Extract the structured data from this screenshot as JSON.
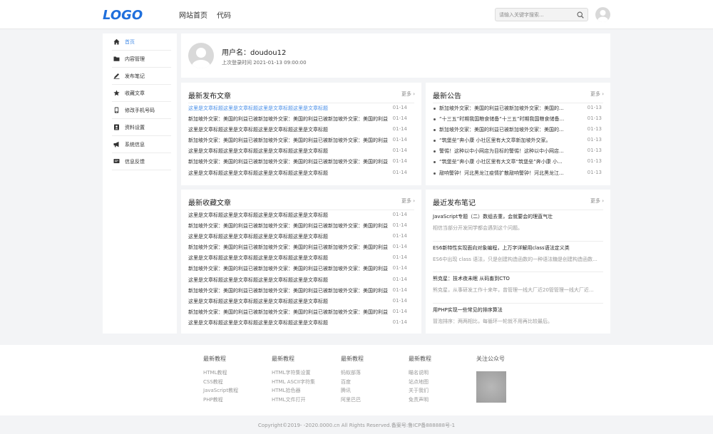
{
  "header": {
    "logo_text": "LOGO",
    "nav": [
      "网站首页",
      "代码"
    ],
    "search_placeholder": "请输入关键字搜索..."
  },
  "colors": {
    "accent": "#4a8fe7",
    "logo": "#1f6fdc",
    "background": "#f3f4f6"
  },
  "sidebar": {
    "items": [
      {
        "label": "首页",
        "icon": "home-icon",
        "active": true
      },
      {
        "label": "内容管理",
        "icon": "folder-icon",
        "active": false
      },
      {
        "label": "发布笔记",
        "icon": "pen-icon",
        "active": false
      },
      {
        "label": "收藏文章",
        "icon": "star-icon",
        "active": false
      },
      {
        "label": "修改手机号码",
        "icon": "phone-icon",
        "active": false
      },
      {
        "label": "资料设置",
        "icon": "id-card-icon",
        "active": false
      },
      {
        "label": "系统信息",
        "icon": "megaphone-icon",
        "active": false
      },
      {
        "label": "信息反馈",
        "icon": "message-icon",
        "active": false
      }
    ]
  },
  "profile": {
    "name": "用户名：doudou12",
    "last_login": "上次登录时间   2021-01-13 09:00:00"
  },
  "latest_articles": {
    "title": "最新发布文章",
    "more": "更多 ›",
    "rows": [
      {
        "title": "这里是文章标题这里是文章标题这里是文章标题这里是文章标题",
        "date": "01-14"
      },
      {
        "title": "新加坡外交家：美国的利益已被新加坡外交家：美国的利益已被新加坡外交家：美国的利益已...",
        "date": "01-14"
      },
      {
        "title": "这里是文章标题这里是文章标题这里是文章标题这里是文章标题",
        "date": "01-14"
      },
      {
        "title": "新加坡外交家：美国的利益已被新加坡外交家：美国的利益已被新加坡外交家：美国的利益已...",
        "date": "01-14"
      },
      {
        "title": "这里是文章标题这里是文章标题这里是文章标题这里是文章标题",
        "date": "01-14"
      },
      {
        "title": "新加坡外交家：美国的利益已被新加坡外交家：美国的利益已被新加坡外交家：美国的利益已...",
        "date": "01-14"
      },
      {
        "title": "这里是文章标题这里是文章标题这里是文章标题这里是文章标题",
        "date": "01-14"
      }
    ]
  },
  "announcements": {
    "title": "最新公告",
    "more": "更多 ›",
    "rows": [
      {
        "title": "新加坡外交家：美国的利益已被新加坡外交家：美国的...",
        "date": "01-13"
      },
      {
        "title": "“十三五”时期我国粮食储备“十三五”时期我国粮食储备...",
        "date": "01-13"
      },
      {
        "title": "新加坡外交家：美国的利益已被新加坡外交家：美国的...",
        "date": "01-13"
      },
      {
        "title": "“筑堡垒”奔小康 小社区里有大文章新加坡外交家。",
        "date": "01-13"
      },
      {
        "title": "警惕！这种以中小网店为目标的警惕！这种以中小网店...",
        "date": "01-13"
      },
      {
        "title": "“筑堡垒”奔小康 小社区里有大文章“筑堡垒”奔小康 小...",
        "date": "01-13"
      },
      {
        "title": "敲响警钟！河北黑龙江疫情扩散敲响警钟！河北黑龙江...",
        "date": "01-13"
      }
    ]
  },
  "favorites": {
    "title": "最新收藏文章",
    "more": "更多 ›",
    "rows": [
      {
        "title": "这里是文章标题这里是文章标题这里是文章标题这里是文章标题",
        "date": "01-14"
      },
      {
        "title": "新加坡外交家：美国的利益已被新加坡外交家：美国的利益已被新加坡外交家：美国的利益已...",
        "date": "01-14"
      },
      {
        "title": "这里是文章标题这里是文章标题这里是文章标题这里是文章标题",
        "date": "01-14"
      },
      {
        "title": "新加坡外交家：美国的利益已被新加坡外交家：美国的利益已被新加坡外交家：美国的利益已...",
        "date": "01-14"
      },
      {
        "title": "这里是文章标题这里是文章标题这里是文章标题这里是文章标题",
        "date": "01-14"
      },
      {
        "title": "新加坡外交家：美国的利益已被新加坡外交家：美国的利益已被新加坡外交家：美国的利益已...",
        "date": "01-14"
      },
      {
        "title": "这里是文章标题这里是文章标题这里是文章标题这里是文章标题",
        "date": "01-14"
      },
      {
        "title": "新加坡外交家：美国的利益已被新加坡外交家：美国的利益已被新加坡外交家：美国的利益已...",
        "date": "01-14"
      },
      {
        "title": "这里是文章标题这里是文章标题这里是文章标题这里是文章标题",
        "date": "01-14"
      },
      {
        "title": "新加坡外交家：美国的利益已被新加坡外交家：美国的利益已被新加坡外交家：美国的利益已...",
        "date": "01-14"
      },
      {
        "title": "这里是文章标题这里是文章标题这里是文章标题这里是文章标题",
        "date": "01-14"
      }
    ]
  },
  "notes": {
    "title": "最近发布笔记",
    "more": "更多 ›",
    "items": [
      {
        "title": "JavaScript专题（二）数组去重，会就要会的理直气壮",
        "desc": "相信当部分开发同学都会遇到这个问题。"
      },
      {
        "title": "ES6新特性实现面向对象编程，上万字详解用class语法定义类",
        "desc": "ES6中出现 class 语法，只是创建构造函数的一种语法糖是创建构造函数..."
      },
      {
        "title": "熊克星：技术夜未眠 从码畜到CTO",
        "desc": "熊克星，从事研发工作十来年，曾管理一线大厂近20管管理一线大厂近..."
      },
      {
        "title": "用PHP实现一些常见的排序算法",
        "desc": "冒泡排序：两两相比，每循环一轮就不用再比较最后。"
      }
    ]
  },
  "footer": {
    "columns": [
      {
        "heading": "最新教程",
        "links": [
          "HTML教程",
          "CSS教程",
          "JavaScript教程",
          "PHP教程"
        ]
      },
      {
        "heading": "最新教程",
        "links": [
          "HTML字符集设置",
          "HTML ASCII字符集",
          "HTML拾色器",
          "HTML文件打开"
        ]
      },
      {
        "heading": "最新教程",
        "links": [
          "蚂蚁部落",
          "百度",
          "腾讯",
          "阿里巴巴"
        ]
      },
      {
        "heading": "最新教程",
        "links": [
          "瞄名说明",
          "站点地图",
          "关于我们",
          "免责声明"
        ]
      }
    ],
    "qr_heading": "关注公众号",
    "copyright": "Copyright©2019- -2020.0000.cn All Rights Reserved.备案号:鲁ICP备888888号-1"
  }
}
